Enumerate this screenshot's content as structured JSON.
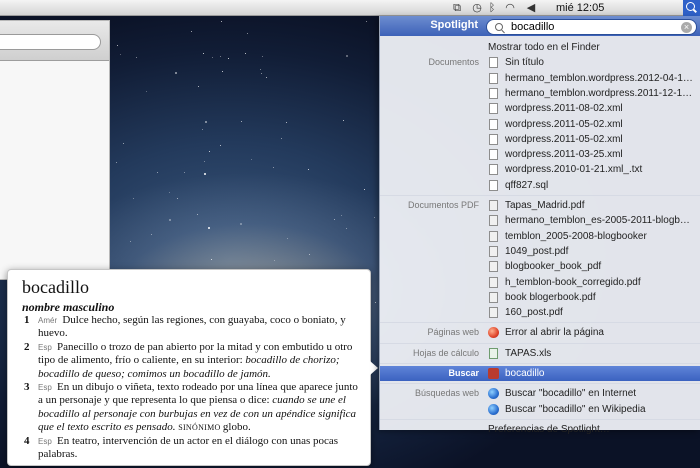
{
  "menubar": {
    "clock": "mié 12:05",
    "icons": [
      "display-icon",
      "time-machine-icon",
      "bluetooth-icon",
      "wifi-icon",
      "volume-icon",
      "spotlight-icon"
    ]
  },
  "dictionary": {
    "word": "bocadillo",
    "pos": "nombre masculino",
    "senses": [
      {
        "num": "1",
        "tag": "Amér",
        "text": "Dulce hecho, según las regiones, con guayaba, coco o boniato, y huevo."
      },
      {
        "num": "2",
        "tag": "Esp",
        "text": "Panecillo o trozo de pan abierto por la mitad y con embutido u otro tipo de alimento, frío o caliente, en su interior:",
        "example": "bocadillo de chorizo; bocadillo de queso; comimos un bocadillo de jamón."
      },
      {
        "num": "3",
        "tag": "Esp",
        "text": "En un dibujo o viñeta, texto rodeado por una línea que aparece junto a un personaje y que representa lo que piensa o dice:",
        "example": "cuando se une el bocadillo al personaje con burbujas en vez de con un apéndice significa que el texto escrito es pensado.",
        "syn_label": "SINÓNIMO",
        "syn": "globo."
      },
      {
        "num": "4",
        "tag": "Esp",
        "text": "En teatro, intervención de un actor en el diálogo con unas pocas palabras."
      }
    ]
  },
  "spotlight": {
    "title": "Spotlight",
    "query": "bocadillo",
    "show_all": "Mostrar todo en el Finder",
    "categories": {
      "documents": "Documentos",
      "pdf": "Documentos PDF",
      "web": "Páginas web",
      "sheets": "Hojas de cálculo",
      "search": "Buscar",
      "web_search": "Búsquedas web"
    },
    "documents": [
      "Sin título",
      "hermano_temblon.wordpress.2012-04-1…",
      "hermano_temblon.wordpress.2011-12-1…",
      "wordpress.2011-08-02.xml",
      "wordpress.2011-05-02.xml",
      "wordpress.2011-05-02.xml",
      "wordpress.2011-03-25.xml",
      "wordpress.2010-01-21.xml_.txt",
      "qff827.sql"
    ],
    "pdfs": [
      "Tapas_Madrid.pdf",
      "hermano_temblon_es-2005-2011-blogb…",
      "temblon_2005-2008-blogbooker",
      "1049_post.pdf",
      "blogbooker_book_pdf",
      "h_temblon-book_corregido.pdf",
      "book blogerbook.pdf",
      "160_post.pdf"
    ],
    "web_page": "Error al abrir la página",
    "sheet": "TAPAS.xls",
    "search_term": "bocadillo",
    "web_searches": [
      "Buscar \"bocadillo\" en Internet",
      "Buscar \"bocadillo\" en Wikipedia"
    ],
    "preferences": "Preferencias de Spotlight…"
  }
}
